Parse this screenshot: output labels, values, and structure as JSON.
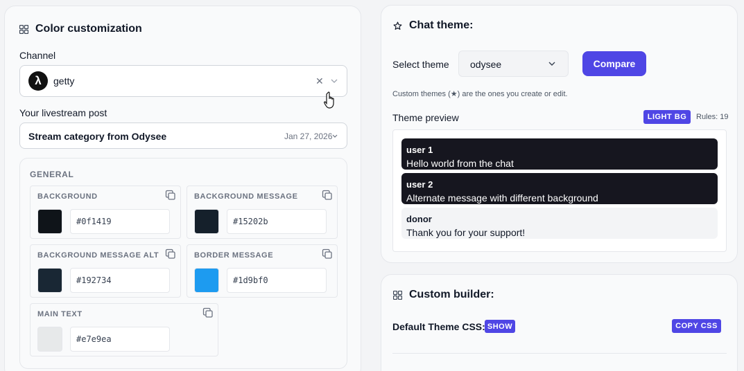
{
  "colors": {
    "accent": "#4f46e5",
    "card_bg": "#f9fafb",
    "message_dark_bg": "#16161f",
    "message_light_bg": "#f3f4f6"
  },
  "color_customization": {
    "title": "Color customization",
    "icon": "grid-icon",
    "channel": {
      "label": "Channel",
      "value": "getty",
      "avatar_glyph": "λ",
      "clear_icon": "close-icon",
      "dropdown_icon": "chevron-down-icon"
    },
    "livestream": {
      "label": "Your livestream post",
      "value": "Stream category from Odysee",
      "date": "Jan 27, 2026"
    },
    "general": {
      "heading": "GENERAL",
      "fields": [
        {
          "label": "BACKGROUND",
          "value": "#0f1419",
          "color": "#0f1419"
        },
        {
          "label": "BACKGROUND MESSAGE",
          "value": "#15202b",
          "color": "#15202b"
        },
        {
          "label": "BACKGROUND MESSAGE ALT",
          "value": "#192734",
          "color": "#192734"
        },
        {
          "label": "BORDER MESSAGE",
          "value": "#1d9bf0",
          "color": "#1d9bf0"
        },
        {
          "label": "MAIN TEXT",
          "value": "#e7e9ea",
          "color": "#e7e9ea"
        }
      ]
    }
  },
  "chat_theme": {
    "title": "Chat theme:",
    "icon": "star-icon",
    "select_label": "Select theme",
    "selected_theme": "odysee",
    "compare_label": "Compare",
    "helper_text": "Custom themes (★) are the ones you create or edit.",
    "preview_label": "Theme preview",
    "preview_badge": "LIGHT BG",
    "rules_text": "Rules: 19",
    "messages": [
      {
        "user": "user 1",
        "text": "Hello world from the chat",
        "variant": "dark"
      },
      {
        "user": "user 2",
        "text": "Alternate message with different background",
        "variant": "dark"
      },
      {
        "user": "donor",
        "text": "Thank you for your support!",
        "variant": "light"
      }
    ]
  },
  "custom_builder": {
    "title": "Custom builder:",
    "icon": "grid-icon",
    "default_css_label": "Default Theme CSS:",
    "show_label": "SHOW",
    "copy_css_label": "COPY CSS"
  }
}
